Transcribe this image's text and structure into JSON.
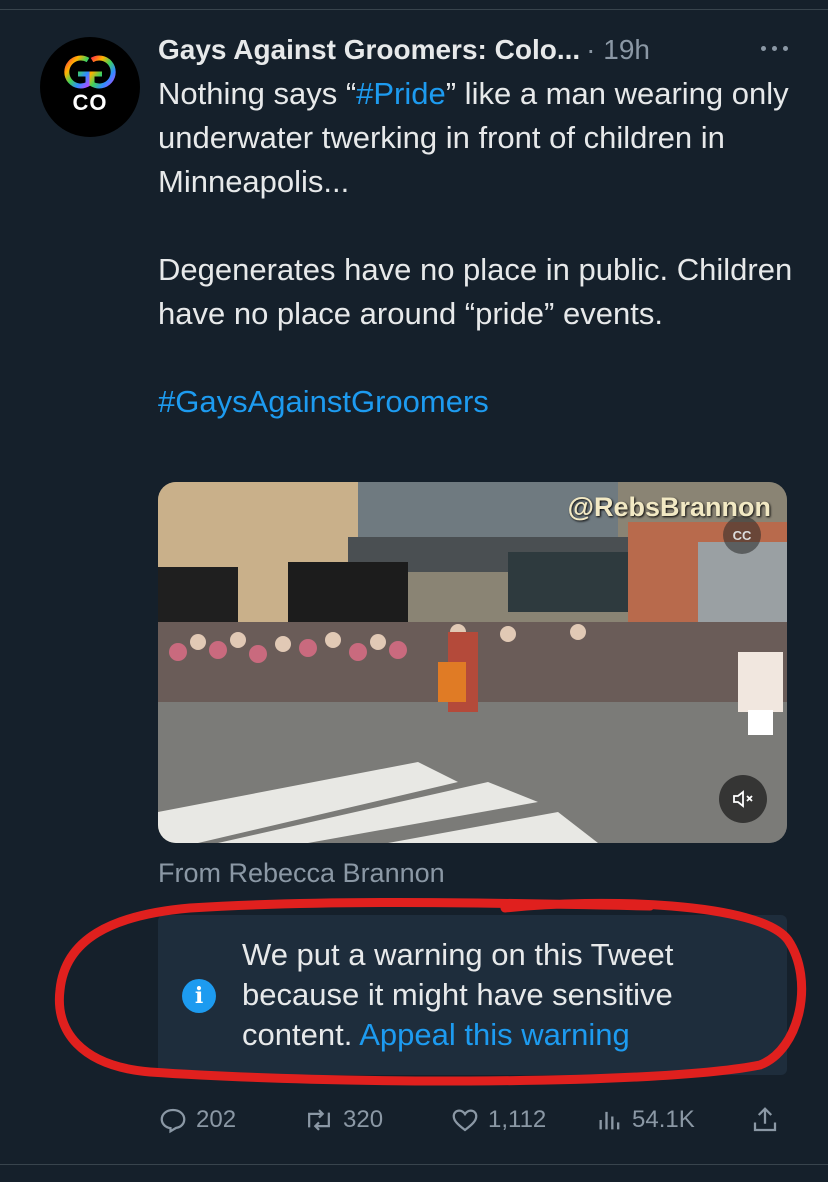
{
  "tweet": {
    "avatar": {
      "text": "CO",
      "icon": "rainbow-gg-logo"
    },
    "author_name": "Gays Against Groomers: Colo...",
    "time": "· 19h",
    "more_icon": "ellipsis-icon",
    "text": {
      "line1_a": "Nothing says “",
      "hashtag_pride": "#Pride",
      "line1_b": "” like a man wearing only underwater twerking in front of children in Minneapolis...",
      "para2": "Degenerates have no place in public. Children have no place around “pride” events.",
      "hashtag_group": "#GaysAgainstGroomers"
    },
    "media": {
      "watermark": "@RebsBrannon",
      "cc_label": "CC",
      "mute_icon": "volume-muted-icon"
    },
    "source": "From Rebecca Brannon",
    "warning": {
      "text": "We put a warning on this Tweet because it might have sensitive content.",
      "appeal_link": "Appeal this warning",
      "icon": "info-icon"
    },
    "actions": {
      "replies": "202",
      "retweets": "320",
      "likes": "1,112",
      "views": "54.1K"
    }
  },
  "colors": {
    "background": "#15202b",
    "link": "#1d9bf0",
    "muted": "#8b98a5",
    "warning_bg": "#1e2d3c",
    "annotation_red": "#e0201e"
  }
}
